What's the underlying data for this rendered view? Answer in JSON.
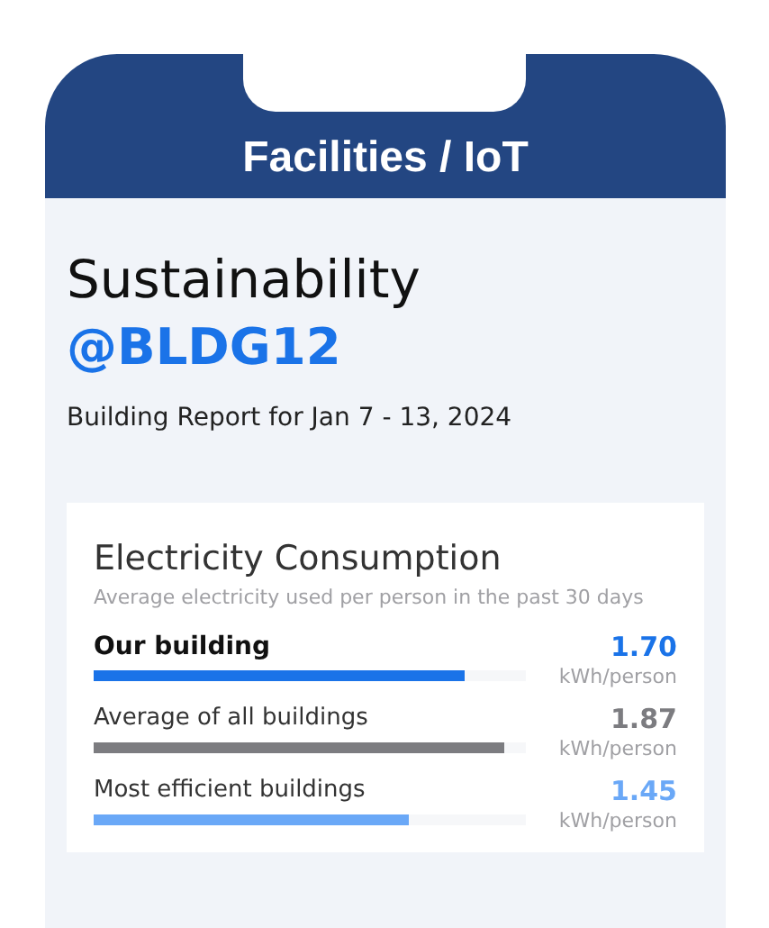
{
  "header": {
    "title": "Facilities / IoT"
  },
  "page": {
    "title": "Sustainability",
    "handle": "@BLDG12",
    "subtitle": "Building Report for Jan 7 - 13, 2024"
  },
  "card": {
    "title": "Electricity Consumption",
    "subtitle": "Average electricity used per person in the past 30 days",
    "rows": [
      {
        "label": "Our building",
        "value": "1.70",
        "unit": "kWh/person",
        "level": 0.86,
        "color": "#1a73e8",
        "selected": true
      },
      {
        "label": "Average of all buildings",
        "value": "1.87",
        "unit": "kWh/person",
        "level": 0.95,
        "color": "#7c7c80",
        "selected": false
      },
      {
        "label": "Most efficient buildings",
        "value": "1.45",
        "unit": "kWh/person",
        "level": 0.73,
        "color": "#6aa8f7",
        "selected": false
      }
    ]
  }
}
